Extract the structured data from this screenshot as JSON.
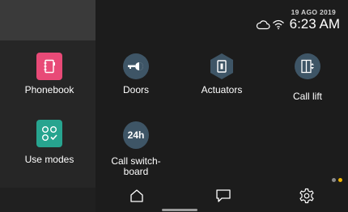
{
  "status": {
    "date": "19 AGO 2019",
    "time": "6:23 AM",
    "icons": [
      "cloud-icon",
      "wifi-icon"
    ]
  },
  "tiles": [
    {
      "label": "Phonebook",
      "icon": "phonebook-icon",
      "color": "#e84a77"
    },
    {
      "label": "Doors",
      "icon": "door-key-icon",
      "color": "#3e5566"
    },
    {
      "label": "Actuators",
      "icon": "actuator-icon",
      "color": "#3e5566"
    },
    {
      "label": "Call lift",
      "icon": "lift-icon",
      "color": "#3e5566"
    },
    {
      "label": "Use modes",
      "icon": "use-modes-icon",
      "color": "#27a48f"
    },
    {
      "label": "Call switch-board",
      "label_line1": "Call switch-",
      "label_line2": "board",
      "badge": "24h",
      "icon": "switchboard-24h-icon",
      "color": "#3e5566"
    }
  ],
  "nav": {
    "items": [
      {
        "name": "home",
        "icon": "home-icon"
      },
      {
        "name": "messages",
        "icon": "message-icon"
      },
      {
        "name": "settings",
        "icon": "settings-icon"
      }
    ]
  },
  "pager": {
    "pages": 2,
    "current": 2,
    "active_color": "#f0b400"
  }
}
